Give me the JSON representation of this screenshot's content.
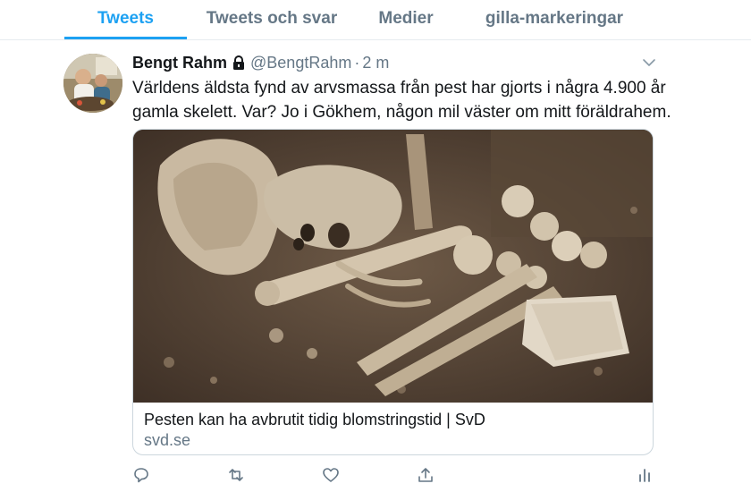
{
  "tabs": [
    {
      "label": "Tweets",
      "active": true
    },
    {
      "label": "Tweets och svar",
      "active": false
    },
    {
      "label": "Medier",
      "active": false
    },
    {
      "label": "gilla-markeringar",
      "active": false
    }
  ],
  "tweet": {
    "author_name": "Bengt Rahm",
    "handle": "@BengtRahm",
    "separator": "·",
    "time": "2 m",
    "text": "Världens äldsta fynd av arvsmassa från pest har gjorts i några 4.900 år gamla skelett. Var? Jo i Gökhem, någon mil väster om mitt föräldrahem.",
    "card": {
      "title": "Pesten kan ha avbrutit tidig blomstringstid | SvD",
      "domain": "svd.se"
    }
  },
  "icons": {
    "lock": "lock-icon",
    "caret": "chevron-down-icon",
    "reply": "reply-icon",
    "retweet": "retweet-icon",
    "like": "heart-icon",
    "share": "share-icon",
    "analytics": "analytics-icon"
  },
  "colors": {
    "accent": "#1da1f2",
    "text_primary": "#14171a",
    "text_secondary": "#657786",
    "border": "#e6ecf0"
  }
}
